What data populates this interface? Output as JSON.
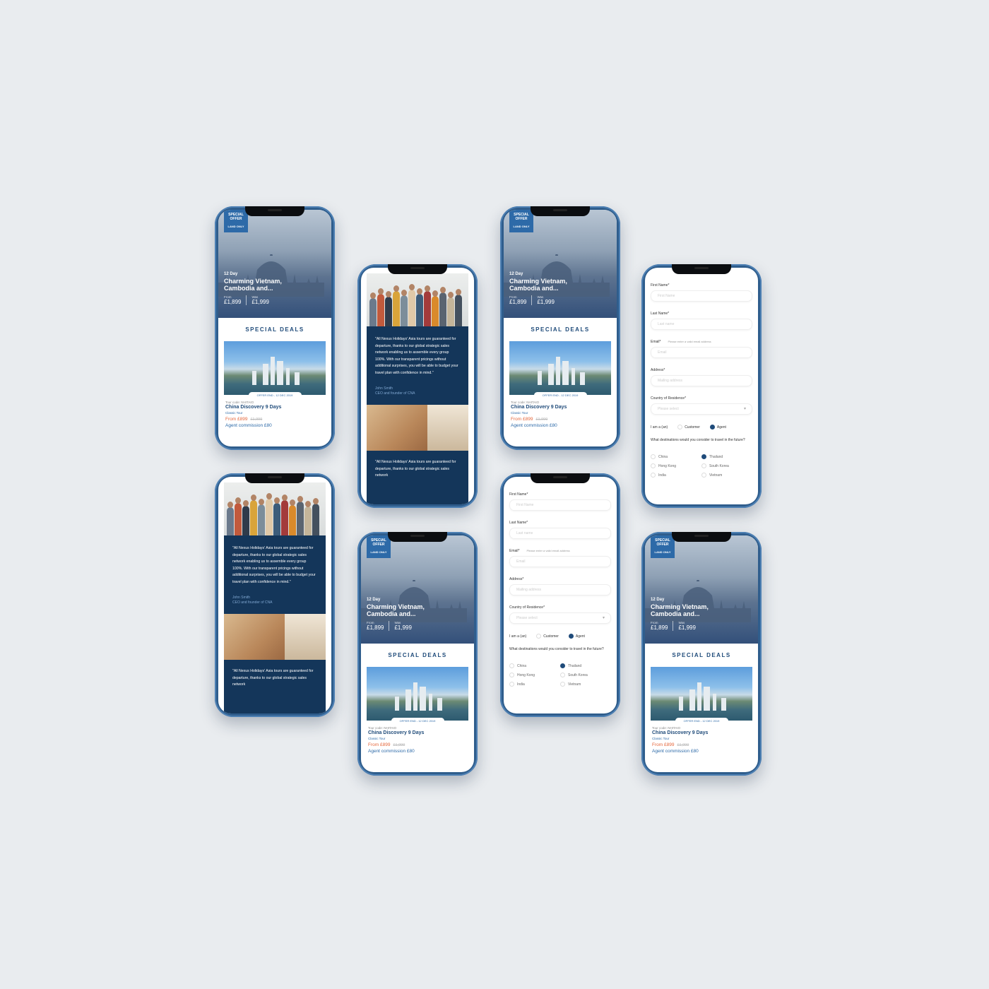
{
  "deals": {
    "tag_line1": "SPECIAL",
    "tag_line2": "OFFER",
    "tag_line3": "LAND ONLY",
    "days": "12 Day",
    "hero_title": "Charming Vietnam, Cambodia and...",
    "from_label": "From",
    "from_price": "£1,899",
    "was_label": "Was",
    "was_price": "£1,999",
    "section_title": "SPECIAL DEALS",
    "offer_end": "OFFER END - 12 DEC 2019",
    "tour_code": "Tour code: NHITAIO",
    "tour_name": "China Discovery 9 Days",
    "tour_type": "Classic Tour",
    "price_from": "From £899",
    "price_was": "£1,999",
    "commission": "Agent commission £80"
  },
  "testimonial": {
    "quote": "\"All Nexus Holidays' Asia tours are guaranteed for departure, thanks to our global strategic sales network enabling us to assemble every group 100%. With our transparent pricings without additional surprises, you will be able to budget your travel plan with confidence in mind.\"",
    "author_name": "John Smith",
    "author_role": "CEO and founder of CNA",
    "quote_short": "\"All Nexus Holidays' Asia tours are guaranteed for departure, thanks to our global strategic sales network"
  },
  "form": {
    "first_name_label": "First Name*",
    "first_name_placeholder": "First Name",
    "last_name_label": "Last Name*",
    "last_name_placeholder": "Last name",
    "email_label": "Email*",
    "email_hint": "Please enter a valid email address",
    "email_placeholder": "Email",
    "address_label": "Address*",
    "address_placeholder": "Mailing address",
    "country_label": "Country of Residence*",
    "country_placeholder": "Please select",
    "iam_label": "I am a (an)",
    "customer_label": "Customer",
    "agent_label": "Agent",
    "question": "What destinations would you consider to travel in the future?",
    "destinations": [
      "China",
      "Thailand",
      "Hong Kong",
      "South Korea",
      "India",
      "Vietnam"
    ],
    "selected_destination": "Thailand",
    "selected_role": "Agent"
  },
  "colors": {
    "background": "#e9ecef",
    "phone_frame": "#2f5d8c",
    "brand_navy": "#14365a",
    "brand_blue": "#2d6aa8",
    "price_orange": "#e5663a"
  }
}
